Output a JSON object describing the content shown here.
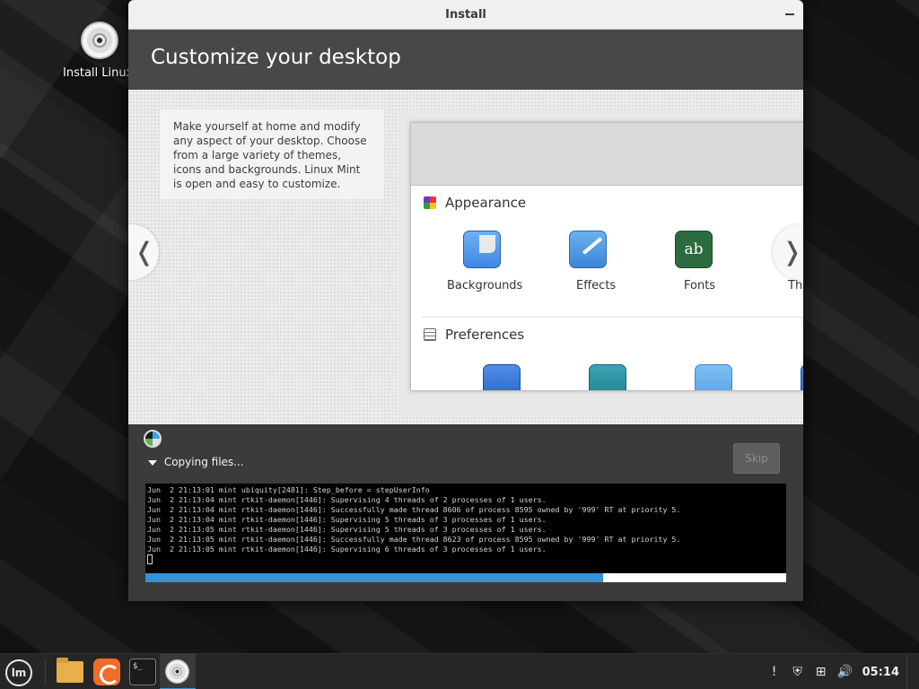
{
  "desktop": {
    "icon_label": "Install Linux"
  },
  "window": {
    "title": "Install",
    "heading": "Customize your desktop",
    "slide": {
      "description": "Make yourself at home and modify any aspect of your desktop. Choose from a large variety of themes, icons and backgrounds. Linux Mint is open and easy to customize.",
      "prev_arrow": "❬",
      "next_arrow": "❭",
      "sections": [
        {
          "title": "Appearance",
          "icon": "appearance-icon",
          "items": [
            {
              "label": "Backgrounds",
              "icon": "backgrounds-icon"
            },
            {
              "label": "Effects",
              "icon": "effects-icon"
            },
            {
              "label": "Fonts",
              "icon": "fonts-icon",
              "glyph": "aᶜ b"
            },
            {
              "label": "Ther",
              "icon": "themes-icon"
            }
          ]
        },
        {
          "title": "Preferences",
          "icon": "preferences-icon",
          "items": [
            {
              "icon": "accessibility-icon"
            },
            {
              "icon": "account-details-icon"
            },
            {
              "icon": "preferred-apps-icon"
            },
            {
              "icon": "date-time-icon"
            }
          ]
        }
      ]
    },
    "progress": {
      "status": "Copying files...",
      "skip_label": "Skip",
      "log_lines": [
        "Jun  2 21:13:01 mint ubiquity[2481]: Step_before = stepUserInfo",
        "Jun  2 21:13:04 mint rtkit-daemon[1446]: Supervising 4 threads of 2 processes of 1 users.",
        "Jun  2 21:13:04 mint rtkit-daemon[1446]: Successfully made thread 8606 of process 8595 owned by '999' RT at priority 5.",
        "Jun  2 21:13:04 mint rtkit-daemon[1446]: Supervising 5 threads of 3 processes of 1 users.",
        "Jun  2 21:13:05 mint rtkit-daemon[1446]: Supervising 5 threads of 3 processes of 1 users.",
        "Jun  2 21:13:05 mint rtkit-daemon[1446]: Successfully made thread 8623 of process 8595 owned by '999' RT at priority 5.",
        "Jun  2 21:13:05 mint rtkit-daemon[1446]: Supervising 6 threads of 3 processes of 1 users."
      ],
      "fraction": 0.714,
      "bar_color": "#3592d6"
    }
  },
  "taskbar": {
    "menu_glyph": "lm",
    "launchers": [
      "files-icon",
      "firefox-icon",
      "terminal-icon",
      "install-disc-icon"
    ],
    "terminal_glyph": "$_",
    "tray": {
      "update_glyph": "!",
      "shield_glyph": "⛨",
      "network_glyph": "⊞",
      "volume_glyph": "🔊",
      "clock": "05:14"
    }
  }
}
